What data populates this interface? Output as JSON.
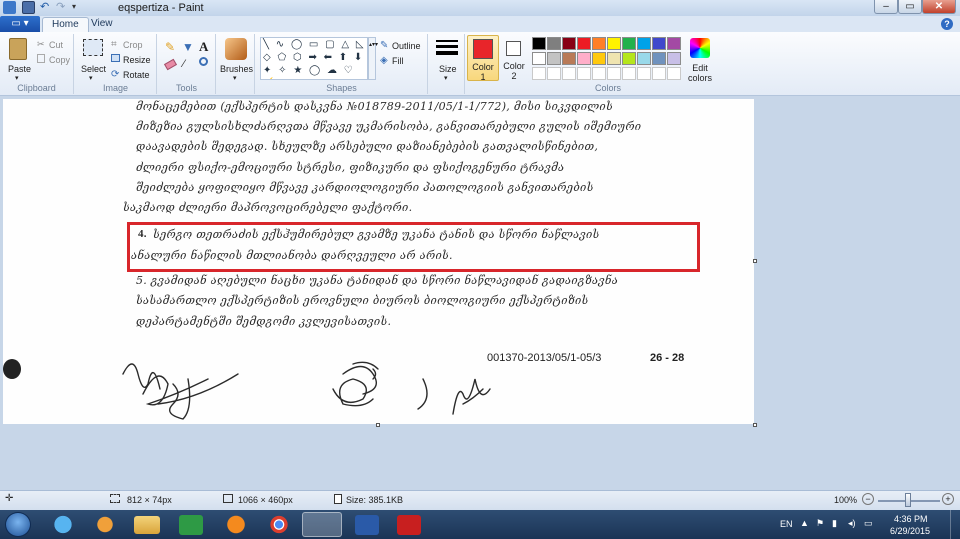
{
  "window": {
    "title": "eqspertiza - Paint"
  },
  "tabs": {
    "file_icon": "paint-menu-icon",
    "home": "Home",
    "view": "View"
  },
  "ribbon": {
    "clipboard": {
      "paste": "Paste",
      "cut": "Cut",
      "copy": "Copy",
      "group": "Clipboard"
    },
    "image": {
      "select": "Select",
      "crop": "Crop",
      "resize": "Resize",
      "rotate": "Rotate",
      "group": "Image"
    },
    "tools": {
      "group": "Tools"
    },
    "brushes": {
      "label": "Brushes"
    },
    "shapes": {
      "outline": "Outline",
      "fill": "Fill",
      "group": "Shapes"
    },
    "size": {
      "label": "Size"
    },
    "color1": {
      "label": "Color 1",
      "value": "#e8252a"
    },
    "color2": {
      "label": "Color 2",
      "value": "#ffffff"
    },
    "colors": {
      "group": "Colors",
      "edit": "Edit colors",
      "palette_row1": [
        "#000000",
        "#7f7f7f",
        "#880015",
        "#ed1c24",
        "#ff7f27",
        "#fff200",
        "#22b14c",
        "#00a2e8",
        "#3f48cc",
        "#a349a4"
      ],
      "palette_row2": [
        "#ffffff",
        "#c3c3c3",
        "#b97a57",
        "#ffaec9",
        "#ffc90e",
        "#efe4b0",
        "#b5e61d",
        "#99d9ea",
        "#7092be",
        "#c8bfe7"
      ]
    }
  },
  "document": {
    "lines": [
      "მონაცემებით (ექსპერტის დასკვნა №018789-2011/05/1-1/772), მისი სიკვდილის",
      "მიზეზია გულსისხლძარღვთა მწვავე უკმარისობა, განვითარებული გულის იშემიური",
      "დაავადების შედეგად. სხეულზე არსებული დაზიანებების გათვალისწინებით,",
      "ძლიერი ფსიქო-ემოციური სტრესი, ფიზიკური და ფსიქოგენური ტრავმა",
      "შეიძლება ყოფილიყო მწვავე კარდიოლოგიური პათოლოგიის განვითარების",
      "საკმაოდ ძლიერი მაპროვოცირებელი ფაქტორი."
    ],
    "item4_number": "4.",
    "item4_line1": "სერგო თეთრაძის ექსჰუმირებულ გვამზე უკანა ტანის და სწორი ნაწლავის",
    "item4_line2": "ანალური ნაწილის მთლიანობა დარღვეული არ არის.",
    "item5_lines": [
      "5. გვამიდან აღებული ნაცხი უკანა ტანიდან და სწორი ნაწლავიდან გადაიგზავნა",
      "სასამართლო ექსპერტიზის ეროვნული ბიუროს ბიოლოგიური ექსპერტიზის",
      "დეპარტამენტში შემდგომი კვლევისათვის."
    ],
    "reference": "001370-2013/05/1-05/3",
    "page": "26 - 28"
  },
  "status": {
    "selection": "812 × 74px",
    "canvas": "1066 × 460px",
    "size": "Size: 385.1KB",
    "zoom": "100%"
  },
  "taskbar": {
    "lang": "EN",
    "time": "4:36 PM",
    "date": "6/29/2015"
  }
}
